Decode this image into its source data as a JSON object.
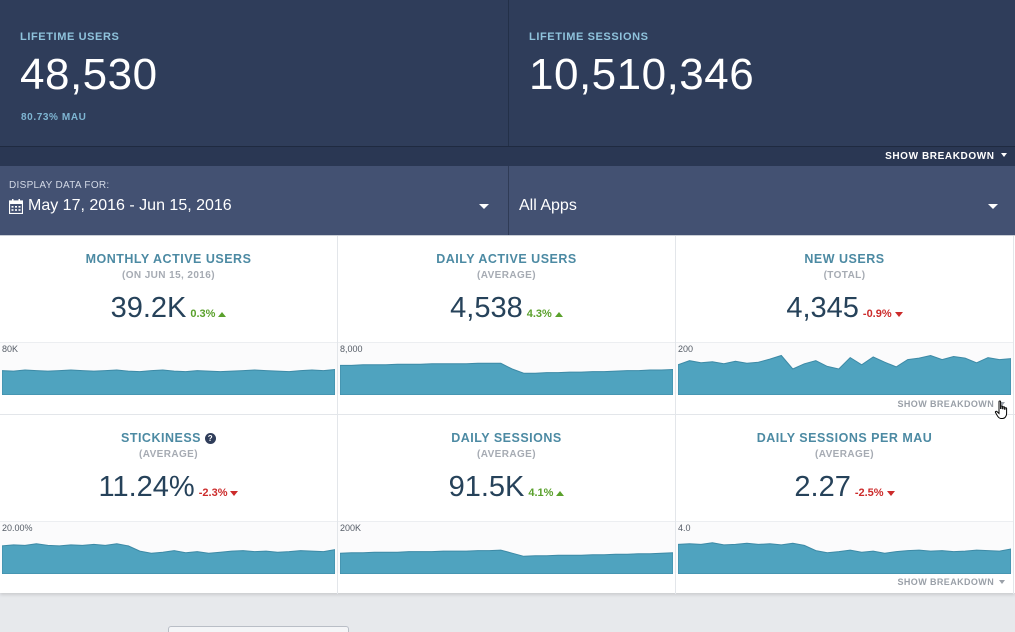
{
  "hero": {
    "lifetime_users": {
      "label": "LIFETIME USERS",
      "value": "48,530",
      "sub": "80.73% MAU"
    },
    "lifetime_sessions": {
      "label": "LIFETIME SESSIONS",
      "value": "10,510,346"
    }
  },
  "breakdown_top": "SHOW BREAKDOWN",
  "filters": {
    "date": {
      "caption": "DISPLAY DATA FOR:",
      "value": "May 17, 2016 - Jun 15, 2016",
      "icon": "calendar-icon"
    },
    "app": {
      "value": "All Apps"
    }
  },
  "colors": {
    "hero_bg": "#2f3d5a",
    "filter_bg": "#435172",
    "accent": "#4c8aa3",
    "spark_fill": "#4fa3bf",
    "up": "#5aa12c",
    "down": "#cc2b2b"
  },
  "cards": [
    {
      "title": "MONTHLY ACTIVE USERS",
      "sub": "(ON JUN 15, 2016)",
      "value": "39.2K",
      "delta": "0.3%",
      "dir": "up",
      "axis_max": "80K",
      "series": [
        0.47,
        0.46,
        0.48,
        0.47,
        0.46,
        0.47,
        0.48,
        0.47,
        0.46,
        0.47,
        0.48,
        0.46,
        0.45,
        0.47,
        0.48,
        0.46,
        0.45,
        0.47,
        0.46,
        0.45,
        0.46,
        0.47,
        0.48,
        0.47,
        0.46,
        0.45,
        0.47,
        0.48,
        0.47,
        0.49
      ]
    },
    {
      "title": "DAILY ACTIVE USERS",
      "sub": "(AVERAGE)",
      "value": "4,538",
      "delta": "4.3%",
      "dir": "up",
      "axis_max": "8,000",
      "series": [
        0.57,
        0.57,
        0.58,
        0.58,
        0.58,
        0.59,
        0.59,
        0.59,
        0.6,
        0.6,
        0.6,
        0.6,
        0.61,
        0.61,
        0.61,
        0.5,
        0.42,
        0.42,
        0.43,
        0.43,
        0.44,
        0.44,
        0.45,
        0.45,
        0.46,
        0.47,
        0.47,
        0.48,
        0.48,
        0.49
      ]
    },
    {
      "title": "NEW USERS",
      "sub": "(TOTAL)",
      "value": "4,345",
      "delta": "-0.9%",
      "dir": "down",
      "axis_max": "200",
      "series": [
        0.58,
        0.66,
        0.62,
        0.64,
        0.6,
        0.65,
        0.61,
        0.63,
        0.69,
        0.76,
        0.5,
        0.6,
        0.66,
        0.55,
        0.5,
        0.72,
        0.58,
        0.73,
        0.63,
        0.54,
        0.68,
        0.71,
        0.76,
        0.68,
        0.74,
        0.71,
        0.62,
        0.72,
        0.68,
        0.7
      ]
    },
    {
      "title": "STICKINESS",
      "sub": "(AVERAGE)",
      "value": "11.24%",
      "delta": "-2.3%",
      "dir": "down",
      "axis_max": "20.00%",
      "series": [
        0.54,
        0.56,
        0.55,
        0.58,
        0.55,
        0.54,
        0.56,
        0.55,
        0.57,
        0.55,
        0.58,
        0.54,
        0.44,
        0.4,
        0.42,
        0.45,
        0.41,
        0.43,
        0.4,
        0.42,
        0.44,
        0.45,
        0.43,
        0.44,
        0.42,
        0.43,
        0.45,
        0.44,
        0.43,
        0.47
      ]
    },
    {
      "title": "DAILY SESSIONS",
      "sub": "(AVERAGE)",
      "value": "91.5K",
      "delta": "4.1%",
      "dir": "up",
      "axis_max": "200K",
      "series": [
        0.4,
        0.41,
        0.41,
        0.42,
        0.42,
        0.42,
        0.43,
        0.43,
        0.43,
        0.44,
        0.44,
        0.44,
        0.45,
        0.45,
        0.46,
        0.4,
        0.34,
        0.35,
        0.35,
        0.36,
        0.36,
        0.36,
        0.37,
        0.37,
        0.38,
        0.38,
        0.39,
        0.39,
        0.4,
        0.41
      ]
    },
    {
      "title": "DAILY SESSIONS PER MAU",
      "sub": "(AVERAGE)",
      "value": "2.27",
      "delta": "-2.5%",
      "dir": "down",
      "axis_max": "4.0",
      "series": [
        0.57,
        0.58,
        0.57,
        0.6,
        0.56,
        0.57,
        0.59,
        0.57,
        0.58,
        0.56,
        0.59,
        0.55,
        0.45,
        0.41,
        0.43,
        0.46,
        0.42,
        0.44,
        0.4,
        0.43,
        0.45,
        0.46,
        0.44,
        0.45,
        0.43,
        0.44,
        0.46,
        0.45,
        0.44,
        0.48
      ]
    }
  ],
  "card_breakdown": "SHOW BREAKDOWN"
}
